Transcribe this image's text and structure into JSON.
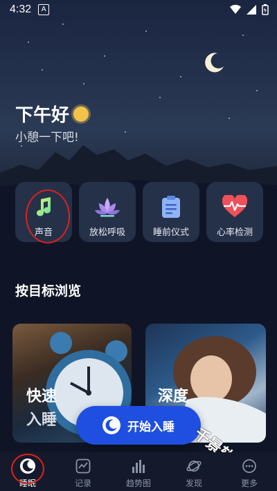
{
  "status_bar": {
    "time": "4:32",
    "notif_badge": "A"
  },
  "greeting": {
    "title": "下午好",
    "subtitle": "小憩一下吧!"
  },
  "quick_actions": [
    {
      "label": "声音",
      "icon": "music-note-icon"
    },
    {
      "label": "放松呼吸",
      "icon": "lotus-icon"
    },
    {
      "label": "睡前仪式",
      "icon": "clipboard-icon"
    },
    {
      "label": "心率检测",
      "icon": "heart-rate-icon"
    }
  ],
  "browse": {
    "title": "按目标浏览",
    "cards": [
      {
        "line1": "快速",
        "line2": "入睡"
      },
      {
        "line1": "深度"
      }
    ]
  },
  "start_button": {
    "label": "开始入睡"
  },
  "watermark": "千景软件站",
  "tabs": [
    {
      "label": "睡眠",
      "icon": "sleep-moon-icon",
      "active": true
    },
    {
      "label": "记录",
      "icon": "record-chart-icon",
      "active": false
    },
    {
      "label": "趋势图",
      "icon": "trend-bars-icon",
      "active": false
    },
    {
      "label": "发现",
      "icon": "planet-icon",
      "active": false
    },
    {
      "label": "更多",
      "icon": "more-icon",
      "active": false
    }
  ],
  "colors": {
    "accent": "#1e4fe0",
    "highlight": "#e0201b",
    "background": "#0f1526"
  }
}
